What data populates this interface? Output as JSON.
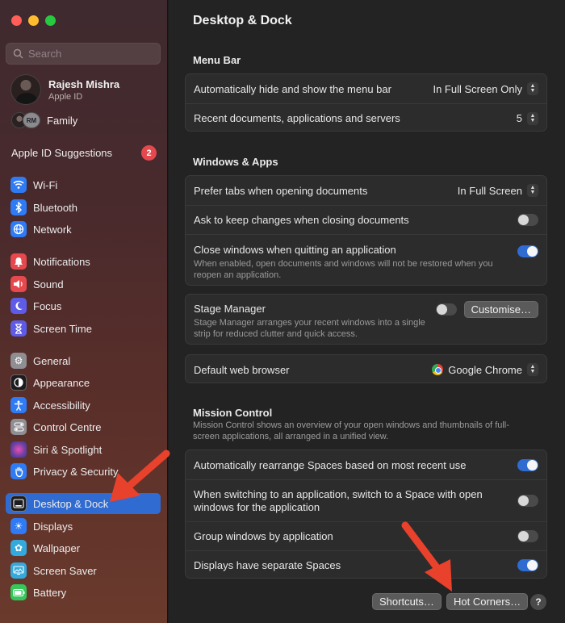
{
  "sidebar": {
    "search_placeholder": "Search",
    "profile": {
      "name": "Rajesh Mishra",
      "subtitle": "Apple ID"
    },
    "family": {
      "initials": "RM",
      "label": "Family"
    },
    "suggestions": {
      "label": "Apple ID Suggestions",
      "badge": "2"
    },
    "items": [
      {
        "label": "Wi-Fi",
        "icon": "wifi-icon",
        "color": "#2f7bf5"
      },
      {
        "label": "Bluetooth",
        "icon": "bluetooth-icon",
        "color": "#2f7bf5"
      },
      {
        "label": "Network",
        "icon": "globe-icon",
        "color": "#2f7bf5"
      },
      {
        "label": "Notifications",
        "icon": "bell-icon",
        "color": "#e5484d"
      },
      {
        "label": "Sound",
        "icon": "speaker-icon",
        "color": "#e5484d"
      },
      {
        "label": "Focus",
        "icon": "moon-icon",
        "color": "#5e5ce6"
      },
      {
        "label": "Screen Time",
        "icon": "hourglass-icon",
        "color": "#5e5ce6"
      },
      {
        "label": "General",
        "icon": "gear-icon",
        "color": "#8e8e93"
      },
      {
        "label": "Appearance",
        "icon": "appearance-icon",
        "color": "#1c1c1e"
      },
      {
        "label": "Accessibility",
        "icon": "accessibility-icon",
        "color": "#2f7bf5"
      },
      {
        "label": "Control Centre",
        "icon": "control-centre-icon",
        "color": "#8e8e93"
      },
      {
        "label": "Siri & Spotlight",
        "icon": "siri-icon",
        "color": "#6b3fa0"
      },
      {
        "label": "Privacy & Security",
        "icon": "hand-icon",
        "color": "#2f7bf5"
      },
      {
        "label": "Desktop & Dock",
        "icon": "dock-icon",
        "color": "#1c1c1e",
        "selected": true
      },
      {
        "label": "Displays",
        "icon": "sun-icon",
        "color": "#2f7bf5"
      },
      {
        "label": "Wallpaper",
        "icon": "flower-icon",
        "color": "#34aadc"
      },
      {
        "label": "Screen Saver",
        "icon": "screen-saver-icon",
        "color": "#34aadc"
      },
      {
        "label": "Battery",
        "icon": "battery-icon",
        "color": "#34c759"
      }
    ]
  },
  "main": {
    "title": "Desktop & Dock",
    "menu_bar": {
      "title": "Menu Bar",
      "auto_hide": {
        "label": "Automatically hide and show the menu bar",
        "value": "In Full Screen Only"
      },
      "recent": {
        "label": "Recent documents, applications and servers",
        "value": "5"
      }
    },
    "windows_apps": {
      "title": "Windows & Apps",
      "prefer_tabs": {
        "label": "Prefer tabs when opening documents",
        "value": "In Full Screen"
      },
      "ask_keep": {
        "label": "Ask to keep changes when closing documents",
        "on": false
      },
      "close_windows": {
        "label": "Close windows when quitting an application",
        "desc": "When enabled, open documents and windows will not be restored when you reopen an application.",
        "on": true
      }
    },
    "stage_manager": {
      "label": "Stage Manager",
      "desc": "Stage Manager arranges your recent windows into a single strip for reduced clutter and quick access.",
      "on": false,
      "button": "Customise…"
    },
    "default_browser": {
      "label": "Default web browser",
      "value": "Google Chrome"
    },
    "mission_control": {
      "title": "Mission Control",
      "desc": "Mission Control shows an overview of your open windows and thumbnails of full-screen applications, all arranged in a unified view.",
      "rows": [
        {
          "label": "Automatically rearrange Spaces based on most recent use",
          "on": true
        },
        {
          "label": "When switching to an application, switch to a Space with open windows for the application",
          "on": false
        },
        {
          "label": "Group windows by application",
          "on": false
        },
        {
          "label": "Displays have separate Spaces",
          "on": true
        }
      ]
    },
    "buttons": {
      "shortcuts": "Shortcuts…",
      "hot_corners": "Hot Corners…",
      "help": "?"
    }
  },
  "annotation_color": "#e8412c"
}
